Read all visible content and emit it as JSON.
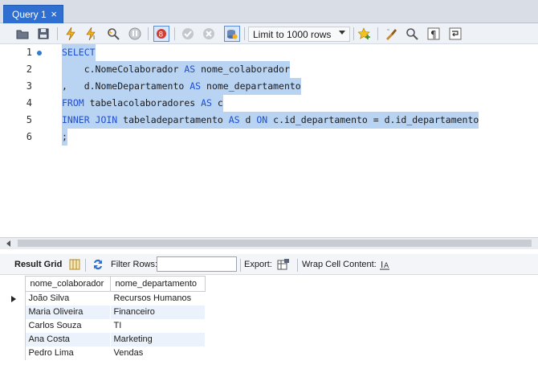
{
  "tab": {
    "title": "Query 1",
    "close": "×"
  },
  "toolbar": {
    "limit_label": "Limit to 1000 rows",
    "icons": [
      "open-folder-icon",
      "save-icon",
      "execute-icon",
      "execute-current-icon",
      "explain-icon",
      "stop-icon",
      "toggle-error-icon",
      "commit-icon",
      "rollback-icon",
      "autocommit-icon",
      "bookmark-icon",
      "beautify-icon",
      "find-icon",
      "invisible-chars-icon",
      "wrap-icon"
    ]
  },
  "editor": {
    "line_numbers": [
      "1",
      "2",
      "3",
      "4",
      "5",
      "6"
    ],
    "lines": [
      [
        {
          "t": "SELECT",
          "k": true
        }
      ],
      [
        {
          "t": "    c.NomeColaborador ",
          "k": false
        },
        {
          "t": "AS",
          "k": true
        },
        {
          "t": " nome_colaborador",
          "k": false
        }
      ],
      [
        {
          "t": ",   d.NomeDepartamento ",
          "k": false
        },
        {
          "t": "AS",
          "k": true
        },
        {
          "t": " nome_departamento",
          "k": false
        }
      ],
      [
        {
          "t": "FROM",
          "k": true
        },
        {
          "t": " tabelacolaboradores ",
          "k": false
        },
        {
          "t": "AS",
          "k": true
        },
        {
          "t": " c",
          "k": false
        }
      ],
      [
        {
          "t": "INNER JOIN",
          "k": true
        },
        {
          "t": " tabeladepartamento ",
          "k": false
        },
        {
          "t": "AS",
          "k": true
        },
        {
          "t": " d ",
          "k": false
        },
        {
          "t": "ON",
          "k": true
        },
        {
          "t": " c.id_departamento = d.id_departamento",
          "k": false
        }
      ],
      [
        {
          "t": ";",
          "k": false
        }
      ]
    ]
  },
  "results_toolbar": {
    "result_grid": "Result Grid",
    "filter_rows": "Filter Rows:",
    "filter_value": "",
    "export": "Export:",
    "wrap": "Wrap Cell Content:"
  },
  "grid": {
    "columns": [
      "nome_colaborador",
      "nome_departamento"
    ],
    "rows": [
      [
        "João Silva",
        "Recursos Humanos"
      ],
      [
        "Maria Oliveira",
        "Financeiro"
      ],
      [
        "Carlos Souza",
        "TI"
      ],
      [
        "Ana Costa",
        "Marketing"
      ],
      [
        "Pedro Lima",
        "Vendas"
      ]
    ]
  }
}
